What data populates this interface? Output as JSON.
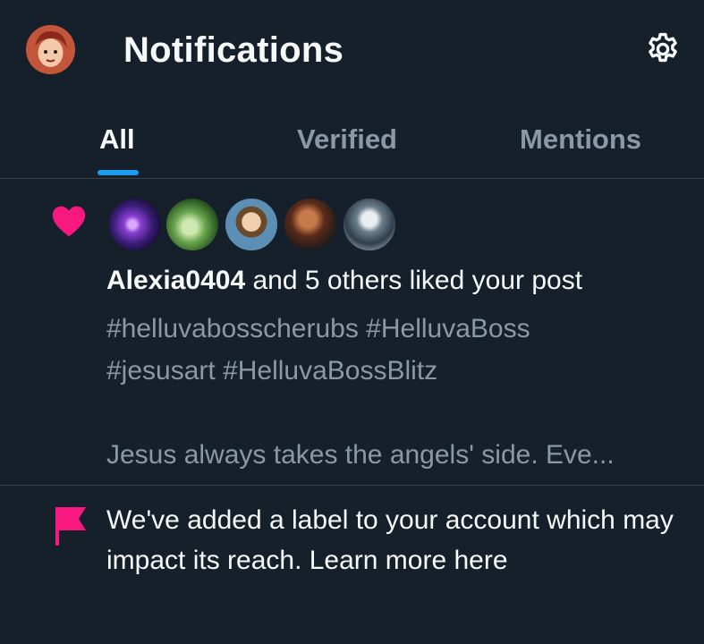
{
  "header": {
    "title": "Notifications",
    "avatar_icon": "profile-avatar",
    "settings_icon": "gear-icon"
  },
  "tabs": [
    {
      "label": "All",
      "active": true
    },
    {
      "label": "Verified",
      "active": false
    },
    {
      "label": "Mentions",
      "active": false
    }
  ],
  "colors": {
    "background": "#15202b",
    "accent": "#1d9bf0",
    "like_pink": "#f91880",
    "muted_text": "#8b98a5",
    "divider": "#38444d"
  },
  "notifications": [
    {
      "type": "like",
      "icon": "heart-icon",
      "user": "Alexia0404",
      "action_text": " and 5 others liked your post",
      "post_lines": [
        "#hellu‍vabosscherubs #HelluvaBoss",
        "#jesusart #HelluvaBossBlitz",
        "",
        "Jesus always takes the angels' side. Eve..."
      ],
      "avatar_count": 5
    },
    {
      "type": "label",
      "icon": "flag-icon",
      "text": "We've added a label to your account which may impact its reach. Learn more here"
    }
  ]
}
